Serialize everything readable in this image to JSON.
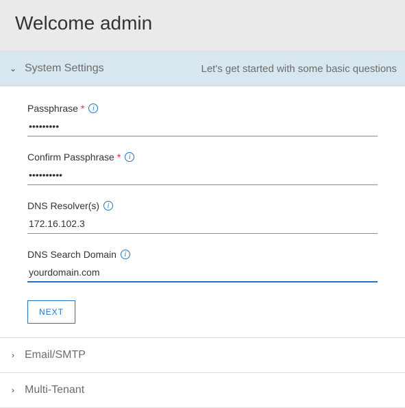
{
  "header": {
    "title": "Welcome admin"
  },
  "sections": {
    "system": {
      "title": "System Settings",
      "subtitle": "Let's get started with some basic questions",
      "expanded": true
    },
    "email": {
      "title": "Email/SMTP",
      "expanded": false
    },
    "multitenant": {
      "title": "Multi-Tenant",
      "expanded": false
    }
  },
  "form": {
    "passphrase": {
      "label": "Passphrase",
      "value": "•••••••••"
    },
    "confirm_passphrase": {
      "label": "Confirm Passphrase",
      "value": "••••••••••"
    },
    "dns_resolvers": {
      "label": "DNS Resolver(s)",
      "value": "172.16.102.3"
    },
    "dns_search_domain": {
      "label": "DNS Search Domain",
      "value": "yourdomain.com"
    },
    "next_label": "NEXT"
  },
  "glyphs": {
    "required": "*",
    "info": "i",
    "chev_down": "⌄",
    "chev_right": "›"
  }
}
